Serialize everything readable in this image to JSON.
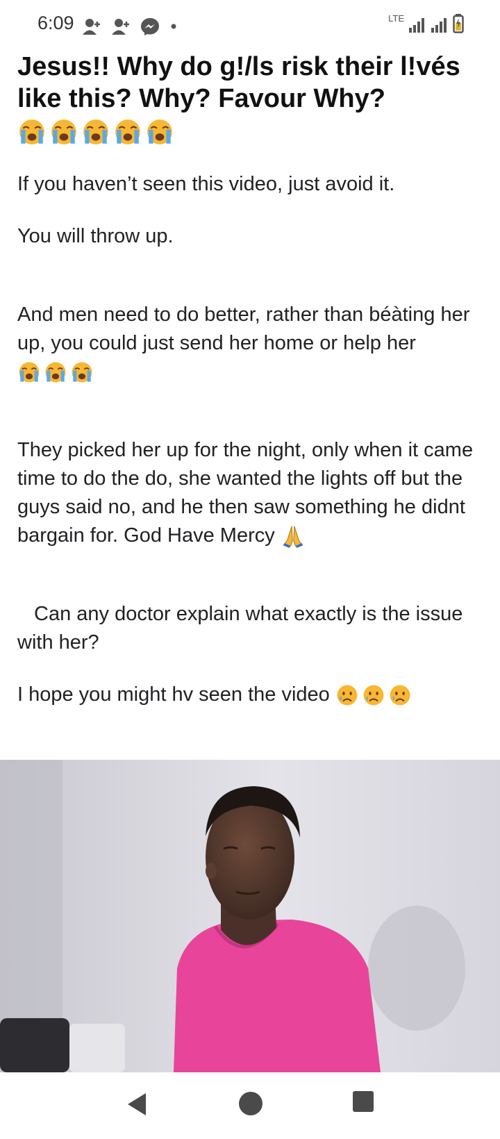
{
  "status_bar": {
    "time": "6:09",
    "notification_icons": [
      "add-friend-icon",
      "add-friend-icon",
      "messenger-icon",
      "dot-icon"
    ],
    "network_label": "LTE",
    "signal_icons": [
      "signal-icon",
      "signal-icon"
    ],
    "battery_icon": "battery-charging-icon"
  },
  "article": {
    "headline": "Jesus!! Why do g!/ls risk their l!vés like this? Why? Favour Why?",
    "headline_emojis": [
      "crying-face",
      "crying-face",
      "crying-face",
      "crying-face",
      "crying-face"
    ],
    "paragraphs": [
      {
        "text": "If you haven’t seen this video, just avoid it."
      },
      {
        "text": "You will throw up."
      },
      {
        "text": "And men need to do better, rather than béàting her up, you could just send her home or help her"
      },
      {
        "text": "They picked her up for the night, only when it came time to do the do, she wanted the lights off but the guys said no, and he then saw something he didnt bargain for. God Have Mercy"
      },
      {
        "text": "Can any doctor explain what exactly is the issue with her?"
      },
      {
        "text": "I hope you might hv seen the video"
      }
    ],
    "paragraph_emojis": {
      "men_paragraph": [
        "crying-face",
        "crying-face",
        "crying-face"
      ],
      "night_paragraph": [
        "folded-hands"
      ],
      "video_paragraph": [
        "sad-face",
        "sad-face",
        "sad-face"
      ]
    }
  },
  "video": {
    "description_icon": "video-still-image",
    "shirt_color": "#e8459a",
    "background_color": "#d8d7de"
  },
  "nav_bar": {
    "icons": [
      "back-icon",
      "home-icon",
      "recents-icon"
    ]
  },
  "colors": {
    "text": "#202124",
    "headline": "#111111",
    "emoji_yellow": "#f7b733",
    "emoji_tear": "#5aa9e6",
    "nav_icon": "#4a4a4a"
  }
}
